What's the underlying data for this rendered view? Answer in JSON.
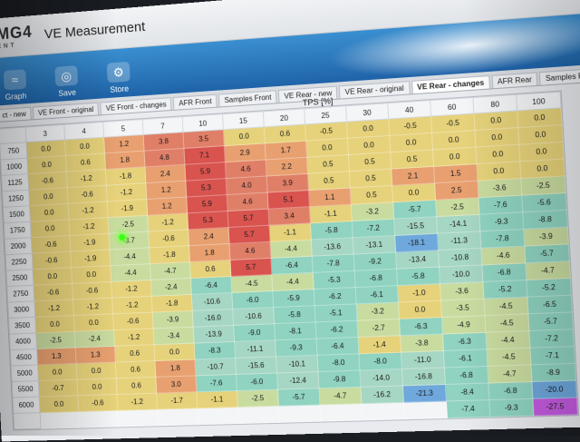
{
  "app": {
    "logo": "MG4",
    "logo_sub": "ENT",
    "title": "VE Measurement"
  },
  "toolbar": [
    {
      "name": "graph",
      "label": "Graph",
      "icon": "graph-icon"
    },
    {
      "name": "save",
      "label": "Save",
      "icon": "save-icon"
    },
    {
      "name": "store",
      "label": "Store",
      "icon": "store-icon"
    }
  ],
  "tabs": [
    {
      "label": "ct - new",
      "active": false
    },
    {
      "label": "VE Front - original",
      "active": false
    },
    {
      "label": "VE Front - changes",
      "active": false
    },
    {
      "label": "AFR Front",
      "active": false
    },
    {
      "label": "Samples Front",
      "active": false
    },
    {
      "label": "VE Rear - new",
      "active": false
    },
    {
      "label": "VE Rear - original",
      "active": false
    },
    {
      "label": "VE Rear - changes",
      "active": true
    },
    {
      "label": "AFR Rear",
      "active": false
    },
    {
      "label": "Samples Rear",
      "active": false
    }
  ],
  "axis_label": "TPS [%]",
  "columns": [
    "3",
    "4",
    "5",
    "7",
    "10",
    "15",
    "20",
    "25",
    "30",
    "40",
    "60",
    "80",
    "100"
  ],
  "rows": [
    {
      "rpm": "750",
      "values": [
        "0.0",
        "0.0",
        "1.2",
        "3.8",
        "3.5",
        "0.0",
        "0.6",
        "-0.5",
        "0.0",
        "-0.5",
        "-0.5",
        "0.0",
        "0.0"
      ]
    },
    {
      "rpm": "1000",
      "values": [
        "0.0",
        "0.6",
        "1.8",
        "4.8",
        "7.1",
        "2.9",
        "1.7",
        "0.0",
        "0.0",
        "0.0",
        "0.0",
        "0.0",
        "0.0"
      ]
    },
    {
      "rpm": "1125",
      "values": [
        "-0.6",
        "-1.2",
        "-1.8",
        "2.4",
        "5.9",
        "4.6",
        "2.2",
        "0.5",
        "0.5",
        "0.5",
        "0.0",
        "0.0",
        "0.0"
      ]
    },
    {
      "rpm": "1250",
      "values": [
        "0.0",
        "-0.6",
        "-1.2",
        "1.2",
        "5.3",
        "4.0",
        "3.9",
        "0.5",
        "0.5",
        "2.1",
        "1.5",
        "0.0",
        "0.0"
      ]
    },
    {
      "rpm": "1500",
      "values": [
        "0.0",
        "-1.2",
        "-1.9",
        "1.2",
        "5.9",
        "4.6",
        "5.1",
        "1.1",
        "0.5",
        "0.0",
        "2.5",
        "-3.6",
        "-2.5"
      ]
    },
    {
      "rpm": "1750",
      "values": [
        "0.0",
        "-1.2",
        "-2.5",
        "-1.2",
        "5.3",
        "5.7",
        "3.4",
        "-1.1",
        "-3.2",
        "-5.7",
        "-2.5",
        "-7.6",
        "-5.6"
      ]
    },
    {
      "rpm": "2000",
      "values": [
        "-0.6",
        "-1.9",
        "-3.7",
        "-0.6",
        "2.4",
        "5.7",
        "-1.1",
        "-5.8",
        "-7.2",
        "-15.5",
        "-14.1",
        "-9.3",
        "-8.8"
      ]
    },
    {
      "rpm": "2250",
      "values": [
        "-0.6",
        "-1.9",
        "-4.4",
        "-1.8",
        "1.8",
        "4.6",
        "-4.4",
        "-13.6",
        "-13.1",
        "-18.1",
        "-11.3",
        "-7.8",
        "-3.9"
      ]
    },
    {
      "rpm": "2500",
      "values": [
        "0.0",
        "0.0",
        "-4.4",
        "-4.7",
        "0.6",
        "5.7",
        "-6.4",
        "-7.8",
        "-9.2",
        "-13.4",
        "-10.8",
        "-4.6",
        "-5.7"
      ]
    },
    {
      "rpm": "2750",
      "values": [
        "-0.6",
        "-0.6",
        "-1.2",
        "-2.4",
        "-6.4",
        "-4.5",
        "-4.4",
        "-5.3",
        "-6.8",
        "-5.8",
        "-10.0",
        "-6.8",
        "-4.7"
      ]
    },
    {
      "rpm": "3000",
      "values": [
        "-1.2",
        "-1.2",
        "-1.2",
        "-1.8",
        "-10.6",
        "-6.0",
        "-5.9",
        "-6.2",
        "-6.1",
        "-1.0",
        "-3.6",
        "-5.2",
        "-5.2"
      ]
    },
    {
      "rpm": "3500",
      "values": [
        "0.0",
        "0.0",
        "-0.6",
        "-3.9",
        "-16.0",
        "-10.6",
        "-5.8",
        "-5.1",
        "-3.2",
        "0.0",
        "-3.5",
        "-4.5",
        "-6.5"
      ]
    },
    {
      "rpm": "4000",
      "values": [
        "-2.5",
        "-2.4",
        "-1.2",
        "-3.4",
        "-13.9",
        "-9.0",
        "-8.1",
        "-6.2",
        "-2.7",
        "-6.3",
        "-4.9",
        "-4.5",
        "-5.7"
      ]
    },
    {
      "rpm": "4500",
      "values": [
        "1.3",
        "1.3",
        "0.6",
        "0.0",
        "-8.3",
        "-11.1",
        "-9.3",
        "-6.4",
        "-1.4",
        "-3.8",
        "-6.3",
        "-4.4",
        "-7.2"
      ]
    },
    {
      "rpm": "5000",
      "values": [
        "0.0",
        "0.0",
        "0.6",
        "1.8",
        "-10.7",
        "-15.6",
        "-10.1",
        "-8.0",
        "-8.0",
        "-11.0",
        "-6.1",
        "-4.5",
        "-7.1"
      ]
    },
    {
      "rpm": "5500",
      "values": [
        "-0.7",
        "0.0",
        "0.6",
        "3.0",
        "-7.6",
        "-6.0",
        "-12.4",
        "-9.8",
        "-14.0",
        "-16.8",
        "-6.8",
        "-4.7",
        "-8.9"
      ]
    },
    {
      "rpm": "6000",
      "values": [
        "0.0",
        "-0.6",
        "-1.2",
        "-1.7",
        "-1.1",
        "-2.5",
        "-5.7",
        "-4.7",
        "-16.2",
        "-21.3",
        "-8.4",
        "-6.8",
        "-20.0"
      ]
    },
    {
      "rpm": "",
      "values": [
        "",
        "",
        "",
        "",
        "",
        "",
        "",
        "",
        "",
        "",
        "-7.4",
        "-9.3",
        "-27.5"
      ]
    }
  ],
  "colors": {
    "pos_strong": "#d9534f",
    "pos_mid": "#e8a070",
    "neutral": "#e6d27a",
    "neg_mid": "#8fd3c0",
    "neg_strong": "#6fa8dc",
    "extreme_neg": "#c45be0"
  }
}
